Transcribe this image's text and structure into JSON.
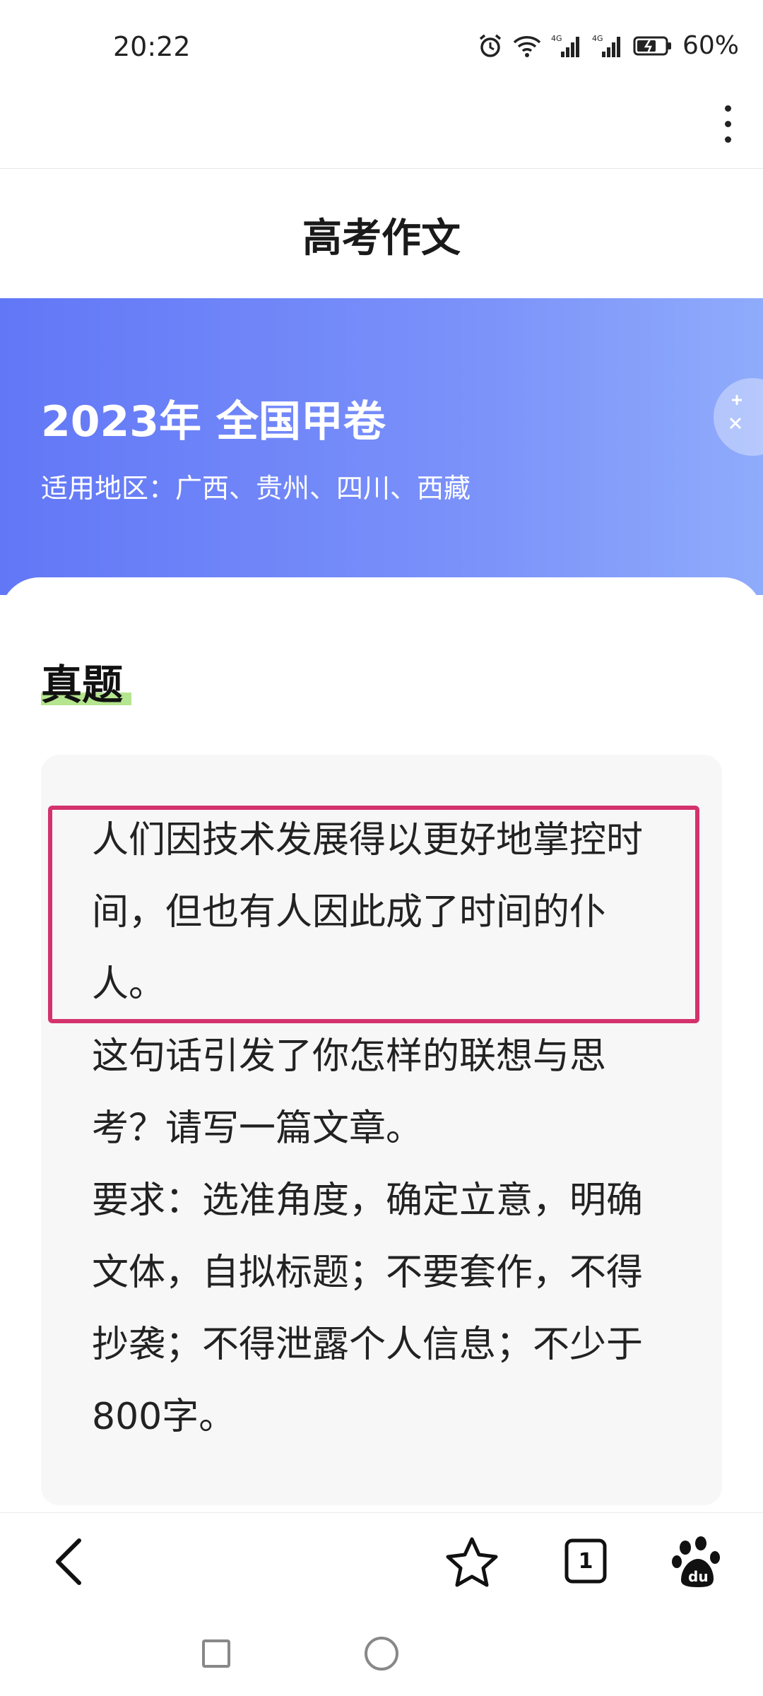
{
  "status_bar": {
    "time": "20:22",
    "battery_percent": "60%",
    "icons": [
      "alarm-icon",
      "wifi-icon",
      "signal-4g-icon",
      "signal-4g-icon",
      "battery-icon"
    ]
  },
  "app_bar": {
    "title": "高考作文",
    "more_icon": "more-vertical-icon"
  },
  "banner": {
    "title": "2023年 全国甲卷",
    "subtitle": "适用地区：广西、贵州、四川、西藏",
    "gradient_start": "#6277f6",
    "gradient_end": "#8fabfb"
  },
  "content": {
    "section_title": "真题",
    "question_paragraphs": [
      "人们因技术发展得以更好地掌控时间，但也有人因此成了时间的仆人。",
      "这句话引发了你怎样的联想与思考？请写一篇文章。",
      "要求：选准角度，确定立意，明确文体，自拟标题；不要套作，不得抄袭；不得泄露个人信息；不少于800字。"
    ],
    "highlight_color": "#d4326c",
    "underline_color": "#a8e07a"
  },
  "toolbar": {
    "back_icon": "chevron-left-icon",
    "star_icon": "star-icon",
    "tabs_icon": "tabs-icon",
    "tab_count": "1",
    "baidu_icon": "baidu-paw-icon"
  },
  "system_nav": {
    "recents_icon": "square-icon",
    "home_icon": "circle-icon"
  }
}
